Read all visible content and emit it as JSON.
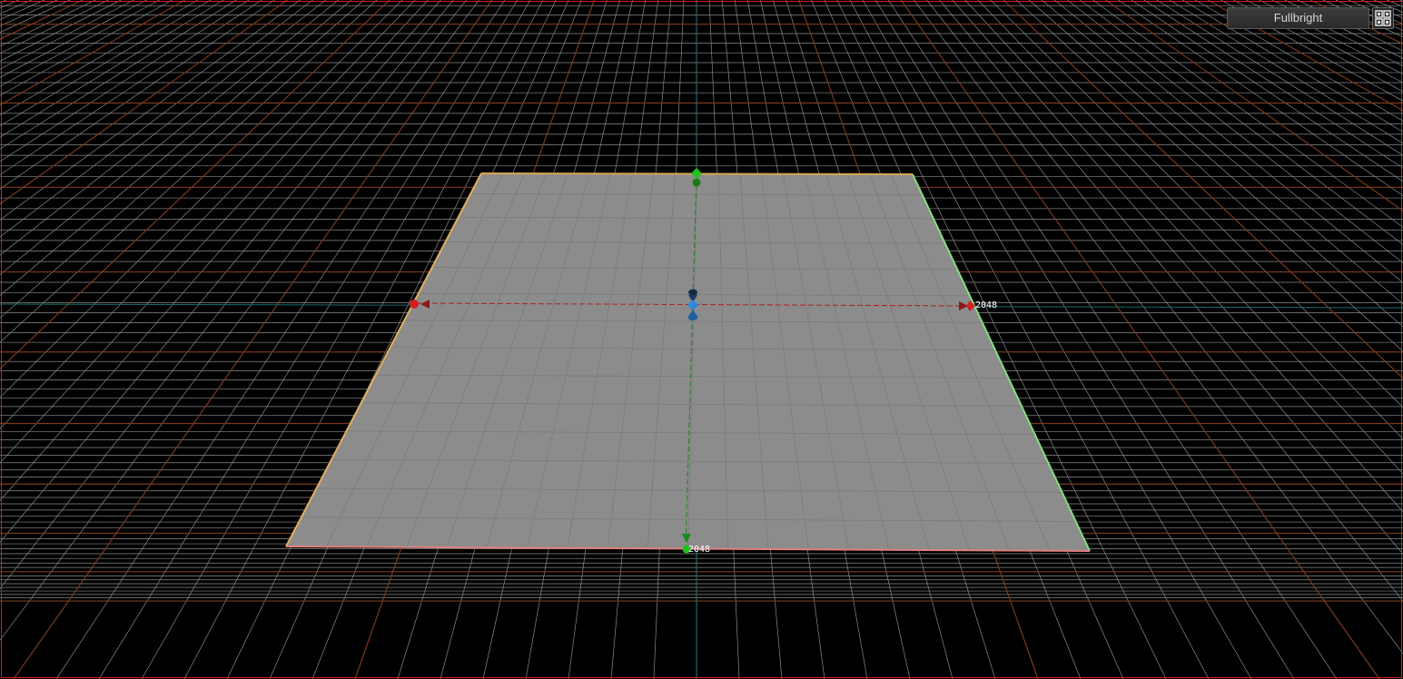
{
  "viewport": {
    "render_mode_label": "Fullbright",
    "layout_icon": "viewport-layout-grid-icon",
    "dimension_x_label": "2048",
    "dimension_y_label": "2048"
  },
  "colors": {
    "background": "#000000",
    "grid_line": "#8a8a8a",
    "grid_major_line": "#7a3a1e",
    "axis_line": "#1e6b6b",
    "brush_face": "#8c8c8c",
    "brush_edge_left": "#e0b060",
    "brush_edge_right": "#80e080",
    "brush_edge_bottom": "#e08080",
    "gizmo_x": "#d02020",
    "gizmo_y": "#20a020",
    "gizmo_z": "#2080e0",
    "viewport_border": "#d81b1b"
  }
}
